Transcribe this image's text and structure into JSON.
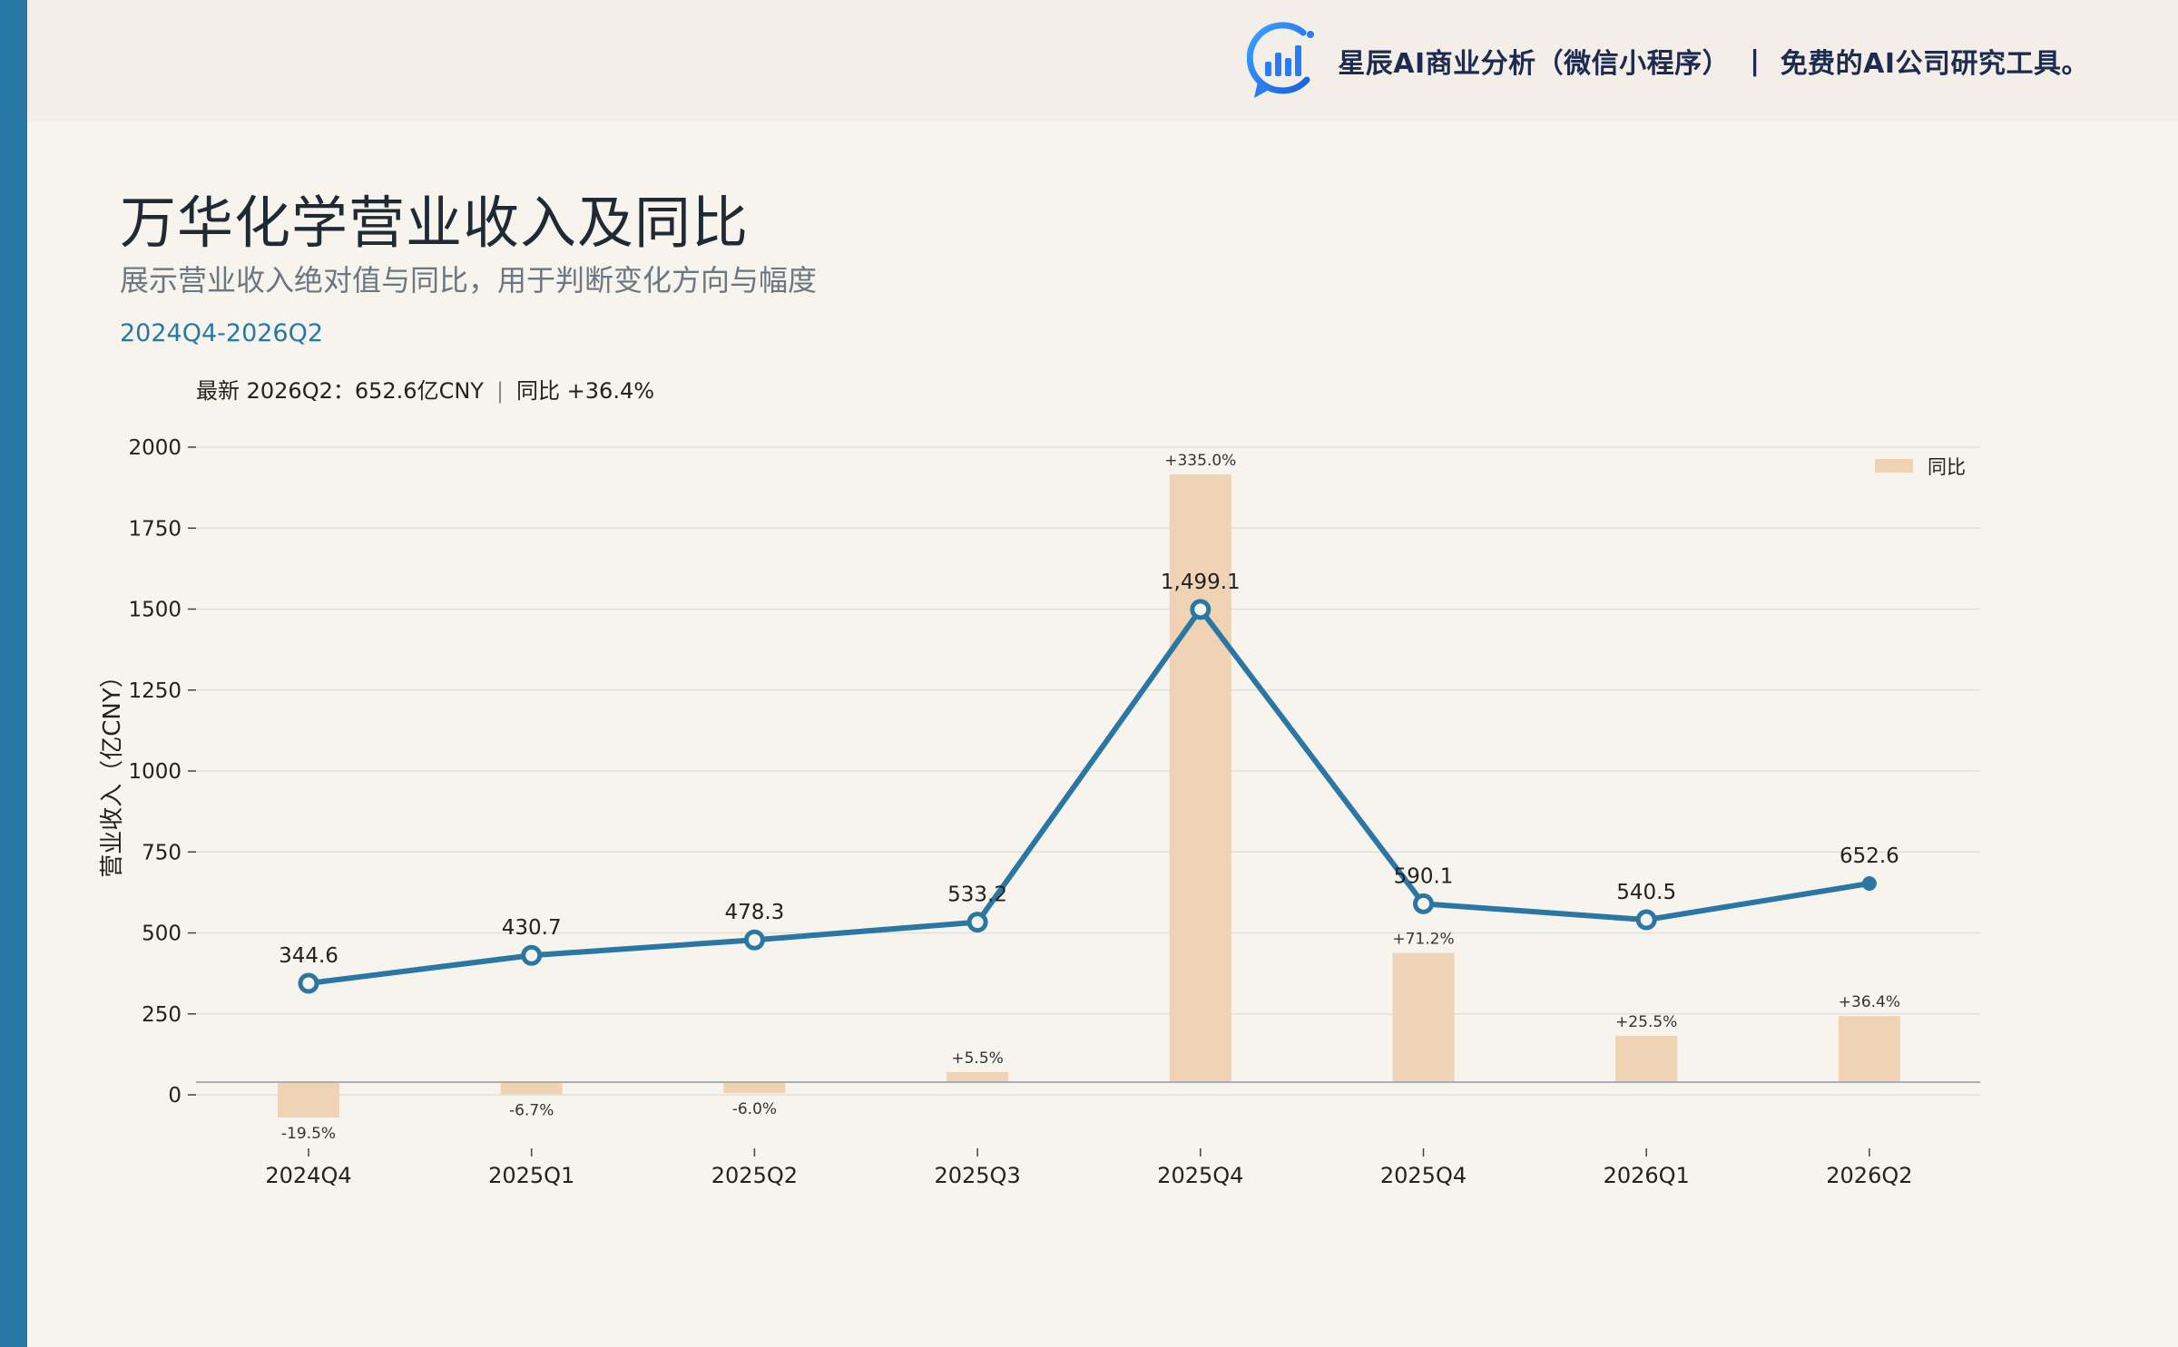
{
  "header": {
    "brand_name": "星辰AI商业分析（微信小程序）",
    "separator": "|",
    "brand_tagline": "免费的AI公司研究工具。",
    "logo_icon": "chart-bubble-logo-icon"
  },
  "title": "万华化学营业收入及同比",
  "subtitle": "展示营业收入绝对值与同比，用于判断变化方向与幅度",
  "period_range": "2024Q4-2026Q2",
  "latest": {
    "label": "最新 2026Q2：652.6亿CNY",
    "sep": "|",
    "yoy": "同比 +36.4%"
  },
  "colors": {
    "line": "#2b77a3",
    "bar": "#efd3b4",
    "accent": "#2878a6",
    "background": "#f7f4ee"
  },
  "chart_data": {
    "type": "bar+line",
    "categories": [
      "2024Q4",
      "2025Q1",
      "2025Q2",
      "2025Q3",
      "2025Q4",
      "2025Q4",
      "2026Q1",
      "2026Q2"
    ],
    "series": [
      {
        "type": "line",
        "axis": "left",
        "values": [
          344.6,
          430.7,
          478.3,
          533.2,
          1499.1,
          590.1,
          540.5,
          652.6
        ],
        "labels": [
          "344.6",
          "430.7",
          "478.3",
          "533.2",
          "1,499.1",
          "590.1",
          "540.5",
          "652.6"
        ]
      },
      {
        "name": "同比",
        "type": "bar",
        "axis": "right-hidden",
        "values": [
          -19.5,
          -6.7,
          -6.0,
          5.5,
          335.0,
          71.2,
          25.5,
          36.4
        ],
        "labels": [
          "-19.5%",
          "-6.7%",
          "-6.0%",
          "+5.5%",
          "+335.0%",
          "+71.2%",
          "+25.5%",
          "+36.4%"
        ]
      }
    ],
    "ylabel": "营业收入（亿CNY）",
    "ylim": [
      0,
      2000
    ],
    "yticks": [
      0,
      250,
      500,
      750,
      1000,
      1250,
      1500,
      1750,
      2000
    ],
    "grid": true,
    "legend": [
      "同比"
    ],
    "legend_position": "top-right"
  }
}
